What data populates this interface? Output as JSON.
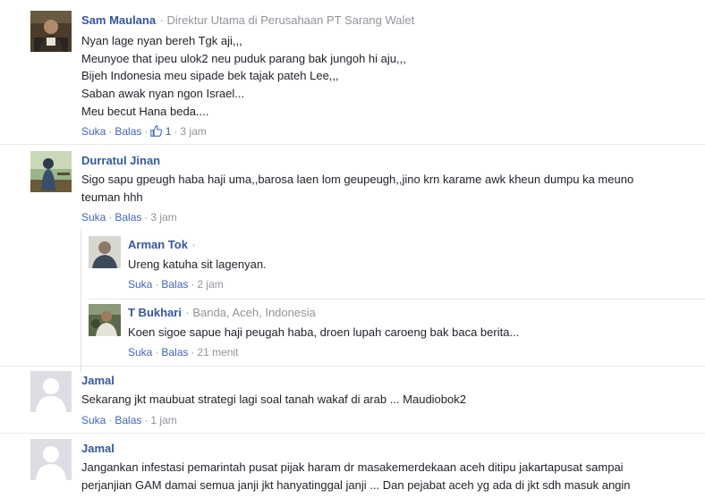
{
  "comments": [
    {
      "name": "Sam Maulana",
      "subtitle": "Direktur Utama di Perusahaan PT Sarang Walet",
      "lines": [
        "Nyan lage nyan bereh Tgk aji,,,",
        "Meunyoe that ipeu ulok2 neu puduk parang bak jungoh hi aju,,,",
        "Bijeh Indonesia meu sipade bek tajak pateh Lee,,,",
        "Saban awak nyan ngon Israel...",
        "Meu becut Hana beda...."
      ],
      "like_label": "Suka",
      "reply_label": "Balas",
      "like_count": "1",
      "time": "3 jam"
    },
    {
      "name": "Durratul Jinan",
      "lines": [
        "Sigo sapu gpeugh haba haji uma,,barosa laen lom geupeugh,,jino krn karame awk kheun dumpu ka meuno",
        "teuman hhh"
      ],
      "like_label": "Suka",
      "reply_label": "Balas",
      "time": "3 jam"
    },
    {
      "name": "Arman Tok",
      "lines": [
        "Ureng katuha sit lagenyan."
      ],
      "like_label": "Suka",
      "reply_label": "Balas",
      "time": "2 jam"
    },
    {
      "name": "T Bukhari",
      "subtitle": "Banda, Aceh, Indonesia",
      "lines": [
        "Koen sigoe sapue haji peugah haba, droen lupah caroeng bak baca berita..."
      ],
      "like_label": "Suka",
      "reply_label": "Balas",
      "time": "21 menit"
    },
    {
      "name": "Jamal",
      "lines": [
        "Sekarang jkt maubuat strategi lagi soal tanah wakaf di arab ... Maudiobok2"
      ],
      "like_label": "Suka",
      "reply_label": "Balas",
      "time": "1 jam"
    },
    {
      "name": "Jamal",
      "lines": [
        "Jangankan infestasi pemarintah pusat pijak haram dr masakemerdekaan aceh ditipu jakartapusat sampai",
        "perjanjian GAM damai semua janji jkt hanyatinggal janji ... Dan pejabat aceh yg ada di jkt sdh masuk angin"
      ]
    }
  ],
  "colors": {
    "name": "#365899",
    "link": "#4267b2",
    "meta": "#90949c",
    "text": "#1d2129"
  }
}
